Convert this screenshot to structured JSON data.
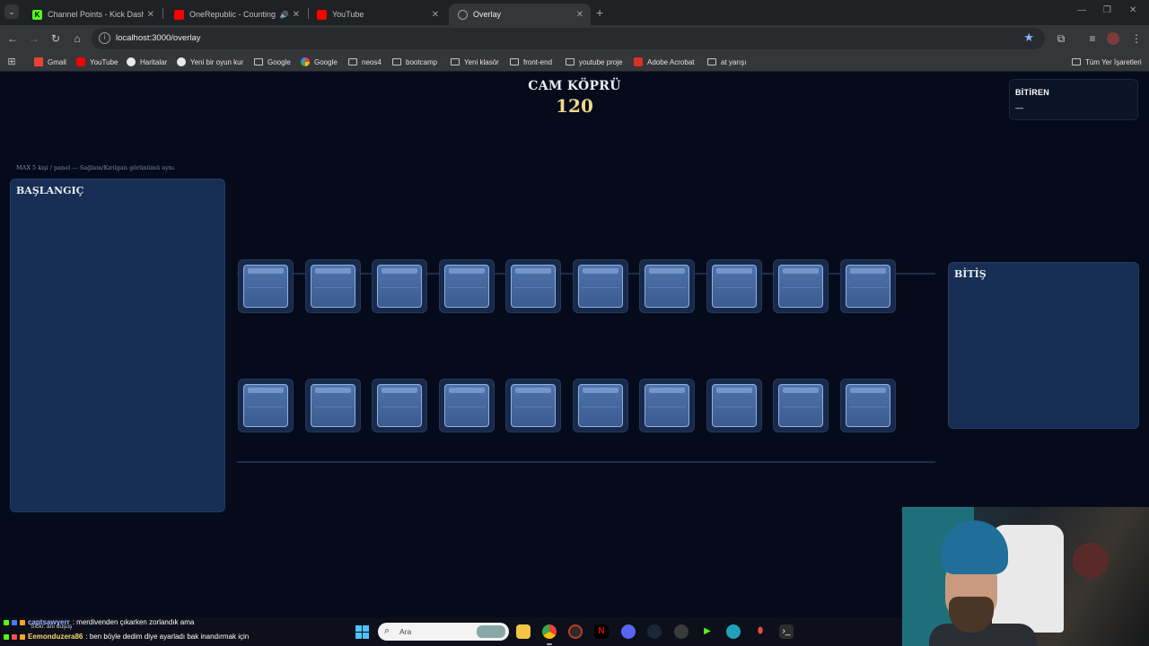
{
  "browser": {
    "tabs": [
      {
        "title": "Channel Points - Kick Dashboard",
        "favicon": "kick-icon",
        "active": false
      },
      {
        "title": "OneRepublic - Counting Stars",
        "favicon": "youtube-icon",
        "active": false
      },
      {
        "title": "YouTube",
        "favicon": "youtube-icon",
        "active": false
      },
      {
        "title": "Overlay",
        "favicon": "globe-icon",
        "active": true
      }
    ],
    "new_tab": "+",
    "address": "localhost:3000/overlay",
    "bookmarks": [
      {
        "label": "Gmail",
        "icon": "gmail-icon"
      },
      {
        "label": "YouTube",
        "icon": "youtube-icon"
      },
      {
        "label": "Haritalar",
        "icon": "maps-icon"
      },
      {
        "label": "Yeni bir oyun kur",
        "icon": "game-icon"
      },
      {
        "label": "Google",
        "icon": "folder-icon"
      },
      {
        "label": "Google",
        "icon": "google-icon"
      },
      {
        "label": "neos4",
        "icon": "folder-icon"
      },
      {
        "label": "bootcamp",
        "icon": "folder-icon"
      },
      {
        "label": "Yeni klasör",
        "icon": "folder-icon"
      },
      {
        "label": "front-end",
        "icon": "folder-icon"
      },
      {
        "label": "youtube proje",
        "icon": "folder-icon"
      },
      {
        "label": "Adobe Acrobat",
        "icon": "pdf-icon"
      },
      {
        "label": "at yarışı",
        "icon": "folder-icon"
      }
    ],
    "all_bookmarks": "Tüm Yer İşaretleri"
  },
  "overlay": {
    "title": "CAM KÖPRÜ",
    "timer": "120",
    "finishers": {
      "label": "BİTİREN",
      "value": "—"
    },
    "note": "MAX 5 kişi / panel — Sağlam/Kırılgan görünümü aynı",
    "start_label": "BAŞLANGIÇ",
    "end_label": "BİTİŞ",
    "rows": 2,
    "tiles_per_row": 10
  },
  "chat": [
    {
      "user": "captsawyerr",
      "message": "merdivenden çıkarken zorlandık ama",
      "color": "#9fb8ff"
    },
    {
      "user": "Eemonduzera86",
      "message": "ben böyle dedim diye ayarladı bak inandırmak için",
      "color": "#f5d76e"
    }
  ],
  "chat_subtitle": "Sıckı: anı duşuş",
  "taskbar": {
    "search_placeholder": "Ara",
    "apps": [
      "file-explorer-icon",
      "chrome-icon",
      "obs-icon",
      "netflix-icon",
      "discord-icon",
      "steam-icon",
      "spotify-icon",
      "game-icon",
      "browser-icon",
      "maps-icon",
      "terminal-icon"
    ]
  }
}
